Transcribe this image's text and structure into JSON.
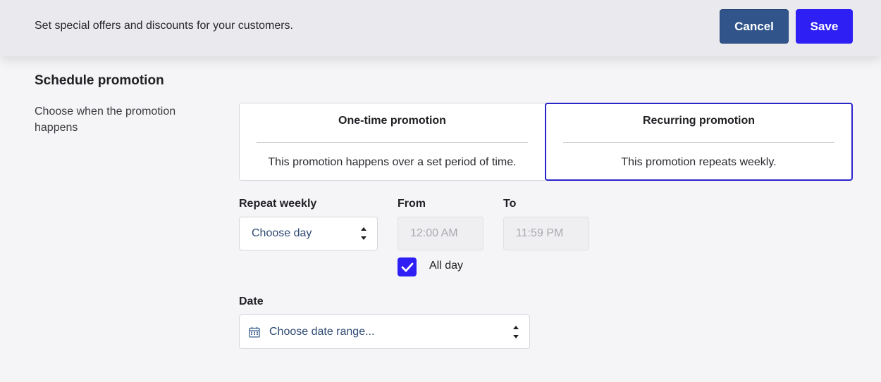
{
  "header": {
    "description": "Set special offers and discounts for your customers.",
    "cancel_label": "Cancel",
    "save_label": "Save"
  },
  "schedule": {
    "title": "Schedule promotion",
    "description": "Choose when the promotion happens",
    "options": [
      {
        "title": "One-time promotion",
        "subtitle": "This promotion happens over a set period of time.",
        "selected": false
      },
      {
        "title": "Recurring promotion",
        "subtitle": "This promotion repeats weekly.",
        "selected": true
      }
    ]
  },
  "recurring": {
    "repeat_label": "Repeat weekly",
    "repeat_value": "Choose day",
    "from_label": "From",
    "from_value": "12:00 AM",
    "to_label": "To",
    "to_value": "11:59 PM",
    "all_day_label": "All day",
    "all_day_checked": true,
    "date_label": "Date",
    "date_value": "Choose date range..."
  },
  "colors": {
    "primary": "#2e1ff5",
    "cancel": "#31558a",
    "selected_border": "#2a25c9",
    "value_text": "#2e4a73"
  },
  "icons": {
    "calendar": "calendar-icon",
    "arrows": "up-down-arrows-icon",
    "check": "checkmark-icon"
  }
}
